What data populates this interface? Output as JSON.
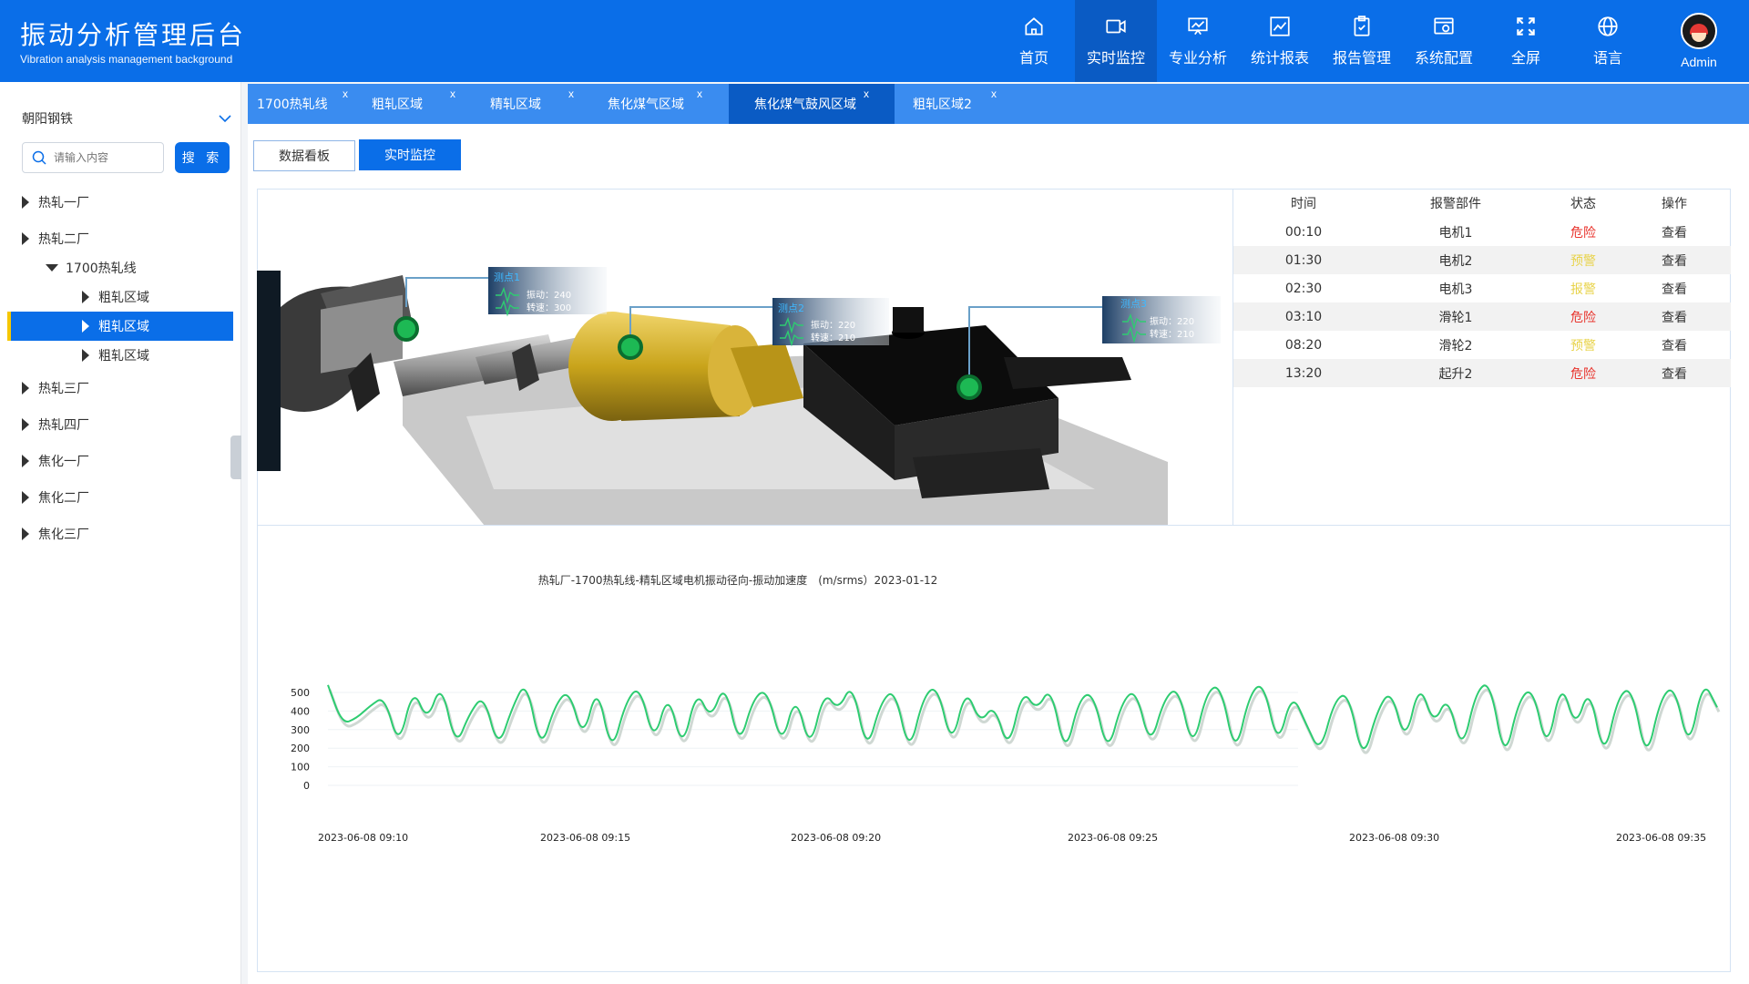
{
  "header": {
    "title": "振动分析管理后台",
    "subtitle": "Vibration analysis management background",
    "nav": [
      {
        "label": "首页",
        "icon": "home-icon"
      },
      {
        "label": "实时监控",
        "icon": "camera-icon"
      },
      {
        "label": "专业分析",
        "icon": "presentation-chart-icon"
      },
      {
        "label": "统计报表",
        "icon": "line-chart-icon"
      },
      {
        "label": "报告管理",
        "icon": "clipboard-check-icon"
      },
      {
        "label": "系统配置",
        "icon": "settings-window-icon"
      },
      {
        "label": "全屏",
        "icon": "fullscreen-icon"
      },
      {
        "label": "语言",
        "icon": "globe-icon"
      }
    ],
    "active_nav": "实时监控",
    "user": "Admin"
  },
  "sidebar": {
    "org": "朝阳钢铁",
    "search_placeholder": "请输入内容",
    "search_button": "搜 索",
    "tree": [
      {
        "label": "热轧一厂",
        "level": 0,
        "expanded": false
      },
      {
        "label": "热轧二厂",
        "level": 0,
        "expanded": false
      },
      {
        "label": "1700热轧线",
        "level": 1,
        "expanded": true
      },
      {
        "label": "粗轧区域",
        "level": 2,
        "expanded": false
      },
      {
        "label": "粗轧区域",
        "level": 2,
        "expanded": false,
        "selected": true
      },
      {
        "label": "粗轧区域",
        "level": 2,
        "expanded": false
      },
      {
        "label": "热轧三厂",
        "level": 0,
        "expanded": false
      },
      {
        "label": "热轧四厂",
        "level": 0,
        "expanded": false
      },
      {
        "label": "焦化一厂",
        "level": 0,
        "expanded": false
      },
      {
        "label": "焦化二厂",
        "level": 0,
        "expanded": false
      },
      {
        "label": "焦化三厂",
        "level": 0,
        "expanded": false
      }
    ]
  },
  "tabs": [
    {
      "label": "1700热轧线",
      "close": "x"
    },
    {
      "label": "粗轧区域",
      "close": "x"
    },
    {
      "label": "精轧区域",
      "close": "x"
    },
    {
      "label": "焦化煤气区域",
      "close": "x"
    },
    {
      "label": "焦化煤气鼓风区域",
      "close": "x",
      "active": true
    },
    {
      "label": "粗轧区域2",
      "close": "x"
    }
  ],
  "view_buttons": {
    "dashboard": "数据看板",
    "realtime": "实时监控"
  },
  "measure_points": [
    {
      "name": "测点1",
      "vib_label": "振动：",
      "vib": "240",
      "speed_label": "转速：",
      "speed": "300"
    },
    {
      "name": "测点2",
      "vib_label": "振动：",
      "vib": "220",
      "speed_label": "转速：",
      "speed": "210"
    },
    {
      "name": "测点3",
      "vib_label": "振动：",
      "vib": "220",
      "speed_label": "转速：",
      "speed": "210"
    }
  ],
  "alarm_table": {
    "headers": [
      "时间",
      "报警部件",
      "状态",
      "操作"
    ],
    "rows": [
      {
        "time": "00:10",
        "part": "电机1",
        "status": "危险",
        "level": "danger",
        "action": "查看"
      },
      {
        "time": "01:30",
        "part": "电机2",
        "status": "预警",
        "level": "warn",
        "action": "查看"
      },
      {
        "time": "02:30",
        "part": "电机3",
        "status": "报警",
        "level": "warn",
        "action": "查看"
      },
      {
        "time": "03:10",
        "part": "滑轮1",
        "status": "危险",
        "level": "danger",
        "action": "查看"
      },
      {
        "time": "08:20",
        "part": "滑轮2",
        "status": "预警",
        "level": "warn",
        "action": "查看"
      },
      {
        "time": "13:20",
        "part": "起升2",
        "status": "危险",
        "level": "danger",
        "action": "查看"
      }
    ]
  },
  "chart_data": {
    "type": "line",
    "title": "热轧厂-1700热轧线-精轧区域电机振动径向-振动加速度　(m/srms）2023-01-12",
    "y_ticks": [
      "0",
      "100",
      "200",
      "300",
      "400",
      "500"
    ],
    "x_ticks": [
      "2023-06-08  09:10",
      "2023-06-08  09:15",
      "2023-06-08  09:20",
      "2023-06-08  09:25",
      "2023-06-08  09:30",
      "2023-06-08  09:35"
    ],
    "ylim": [
      0,
      500
    ],
    "series_color": "#2ecc71",
    "series": [
      {
        "values": [
          540,
          330,
          360,
          430,
          480,
          200,
          530,
          340,
          560,
          200,
          390,
          490,
          190,
          420,
          570,
          180,
          430,
          520,
          240,
          550,
          160,
          450,
          540,
          220,
          510,
          180,
          520,
          350,
          560,
          200,
          470,
          520,
          200,
          500,
          180,
          510,
          400,
          560,
          170,
          450,
          520,
          160,
          480,
          540,
          200,
          530,
          330,
          440,
          180,
          520,
          400,
          540,
          150,
          470,
          500,
          160,
          450,
          520,
          200,
          470,
          530,
          180,
          510,
          540,
          150,
          490,
          560,
          200,
          500,
          330,
          170,
          460,
          500,
          120,
          400,
          520,
          220,
          560,
          320,
          490,
          170,
          510,
          560,
          120,
          460,
          530,
          170,
          570,
          300,
          540,
          130,
          480,
          530,
          120,
          470,
          540,
          180,
          570,
          420
        ]
      }
    ]
  }
}
